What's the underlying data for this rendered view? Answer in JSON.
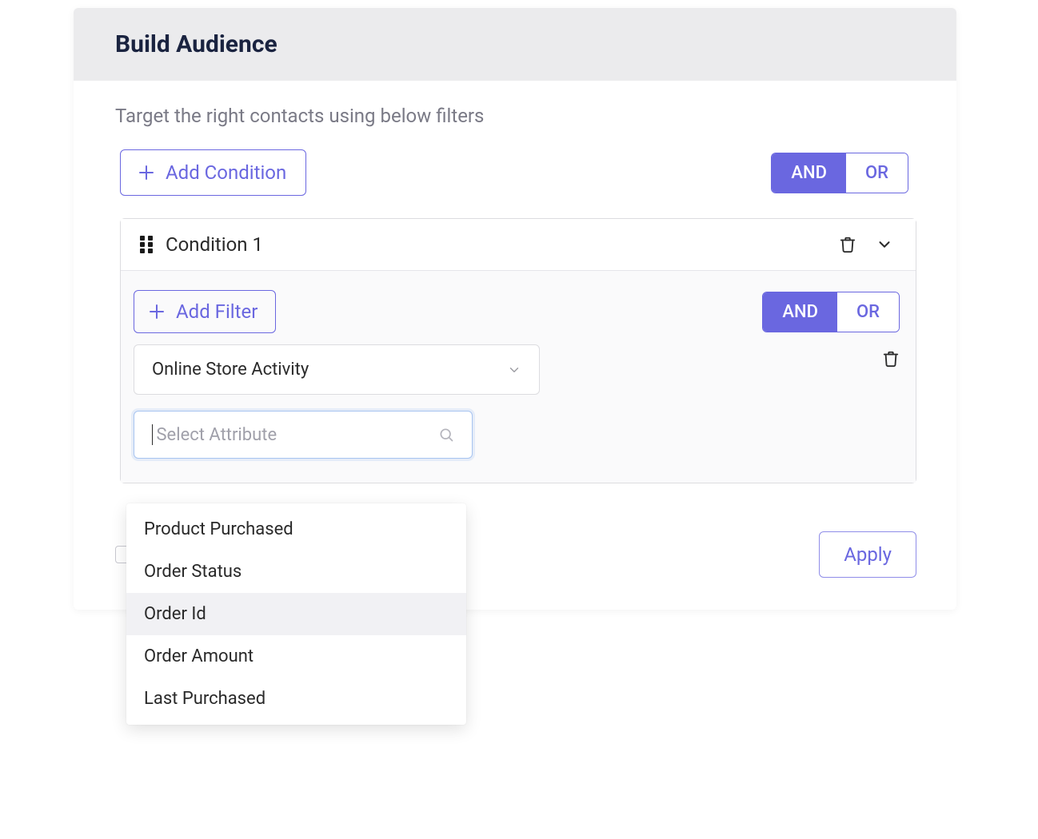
{
  "colors": {
    "accent": "#6a67e0",
    "header_bg": "#ebebed",
    "panel_bg": "#fafafb"
  },
  "header": {
    "title": "Build Audience"
  },
  "subtitle": "Target the right contacts using below filters",
  "toolbar": {
    "add_condition_label": "Add Condition",
    "logic": {
      "and": "AND",
      "or": "OR",
      "active": "AND"
    }
  },
  "condition": {
    "title": "Condition 1",
    "add_filter_label": "Add Filter",
    "logic": {
      "and": "AND",
      "or": "OR",
      "active": "AND"
    },
    "filter": {
      "category_selected": "Online Store Activity",
      "attribute_placeholder": "Select Attribute",
      "attribute_value": ""
    },
    "attribute_options": [
      {
        "label": "Product Purchased",
        "hover": false
      },
      {
        "label": "Order Status",
        "hover": false
      },
      {
        "label": "Order Id",
        "hover": true
      },
      {
        "label": "Order Amount",
        "hover": false
      },
      {
        "label": "Last Purchased",
        "hover": false
      }
    ]
  },
  "footer": {
    "apply_label": "Apply"
  }
}
